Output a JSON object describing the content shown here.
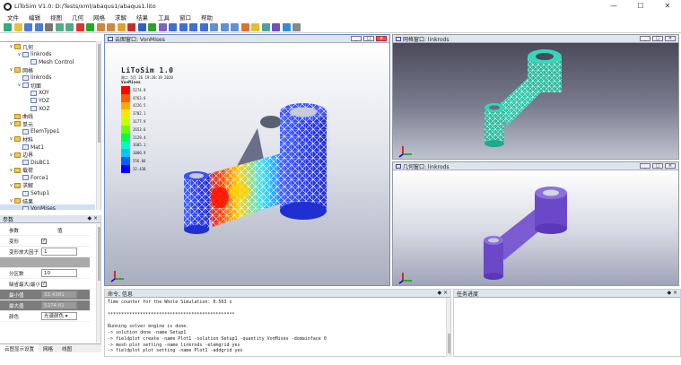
{
  "window": {
    "title": "LiToSim V1.0: D:/Tests/xml/abaqus1/abaqus1.lito",
    "minimize": "—",
    "maximize": "☐",
    "close": "✕"
  },
  "menu": [
    "文件",
    "编辑",
    "视图",
    "几何",
    "网格",
    "求解",
    "结果",
    "工具",
    "窗口",
    "帮助"
  ],
  "toolbar": {
    "icons": [
      "new",
      "open",
      "save",
      "save-all",
      "print",
      "undo",
      "redo",
      "stop",
      "run",
      "import",
      "export",
      "mesh",
      "solve",
      "post",
      "play",
      "select",
      "rotate",
      "pan",
      "zoom",
      "fit",
      "view-front",
      "view-top",
      "view-iso",
      "color",
      "light",
      "wire",
      "shade",
      "export-image",
      "settings"
    ],
    "colors": [
      "#3a7",
      "#e8c040",
      "#4a7ed0",
      "#4a7ed0",
      "#777",
      "#5a8",
      "#5a8",
      "#d33",
      "#2a2",
      "#c84",
      "#c84",
      "#e0a030",
      "#c03030",
      "#3060c0",
      "#30a030",
      "#8060c0",
      "#4070d0",
      "#4070d0",
      "#4070d0",
      "#4070d0",
      "#6090d0",
      "#6090d0",
      "#6090d0",
      "#e07030",
      "#e0c030",
      "#50a0a0",
      "#7050c0",
      "#3090d0",
      "#888"
    ]
  },
  "tree_panel": {
    "header": "项目",
    "buttons": "◆ ×",
    "items": [
      {
        "label": "几何",
        "depth": 1,
        "expand": "∨"
      },
      {
        "label": "linkrods",
        "depth": 2,
        "expand": "∨"
      },
      {
        "label": "Mesh Control",
        "depth": 3,
        "expand": ""
      },
      {
        "label": "网格",
        "depth": 1,
        "expand": "∨"
      },
      {
        "label": "linkrods",
        "depth": 2,
        "expand": ""
      },
      {
        "label": "切面",
        "depth": 2,
        "expand": "∨"
      },
      {
        "label": "XOY",
        "depth": 3,
        "expand": ""
      },
      {
        "label": "YOZ",
        "depth": 3,
        "expand": ""
      },
      {
        "label": "XOZ",
        "depth": 3,
        "expand": ""
      },
      {
        "label": "曲线",
        "depth": 1,
        "expand": ""
      },
      {
        "label": "单元",
        "depth": 1,
        "expand": "∨"
      },
      {
        "label": "ElemType1",
        "depth": 2,
        "expand": ""
      },
      {
        "label": "材料",
        "depth": 1,
        "expand": "∨"
      },
      {
        "label": "Mat1",
        "depth": 2,
        "expand": ""
      },
      {
        "label": "边界",
        "depth": 1,
        "expand": "∨"
      },
      {
        "label": "DisBC1",
        "depth": 2,
        "expand": ""
      },
      {
        "label": "载荷",
        "depth": 1,
        "expand": "∨"
      },
      {
        "label": "Force1",
        "depth": 2,
        "expand": ""
      },
      {
        "label": "求解",
        "depth": 1,
        "expand": "∨"
      },
      {
        "label": "Setup1",
        "depth": 2,
        "expand": ""
      },
      {
        "label": "结果",
        "depth": 1,
        "expand": "∨"
      },
      {
        "label": "VonMises",
        "depth": 2,
        "expand": "",
        "selected": true
      }
    ]
  },
  "params_panel": {
    "header": "参数",
    "buttons": "◆ ×",
    "col1": "参数",
    "col2": "值",
    "rows": [
      {
        "label": "变形",
        "type": "check",
        "value": "✓"
      },
      {
        "label": "变形放大因子",
        "type": "input",
        "value": "1"
      },
      {
        "label": "",
        "type": "gray",
        "value": ""
      },
      {
        "label": "分区数",
        "type": "input",
        "value": "10"
      },
      {
        "label": "缺省最大/最小",
        "type": "check",
        "value": "✓"
      },
      {
        "label": "最小值",
        "type": "input-dark",
        "value": "32.4381"
      },
      {
        "label": "最大值",
        "type": "input-dark",
        "value": "5274.81"
      },
      {
        "label": "颜色",
        "type": "select",
        "value": "光谱颜色"
      }
    ],
    "tabs": [
      "云图显示设置",
      "网格",
      "线图"
    ]
  },
  "viewports": {
    "main": {
      "title": "云图窗口: VonMises"
    },
    "mesh": {
      "title": "网格窗口: linkrods"
    },
    "geom": {
      "title": "几何窗口: linkrods"
    }
  },
  "contour": {
    "app": "LiToSim 1.0",
    "date": "周二 5月 26 19:28:19 2020",
    "variable": "VonMises",
    "levels": [
      "5274.8",
      "4763.6",
      "4226.5",
      "3702.1",
      "3177.9",
      "2653.6",
      "2129.4",
      "1605.1",
      "1080.9",
      "556.66",
      "32.438"
    ],
    "colors": [
      "#ff0000",
      "#ff5a00",
      "#ffaa00",
      "#ffe800",
      "#c8ff00",
      "#6aff00",
      "#00ff40",
      "#00ffc8",
      "#00c8ff",
      "#0060ff",
      "#0000ff"
    ]
  },
  "console": {
    "header": "命令, 信息",
    "buttons": "◆ ×",
    "lines": [
      "Time counter for the Whole Simulation: 0.503 s",
      "",
      "***********************************************",
      "",
      "Running solver engine is done.",
      "-> solution done -name Setup1",
      "-> fieldplot create -name Plot1 -solution Setup1 -quantity VonMises -domainface 0",
      "-> mesh plot setting -name linkrods -elemgrid yes",
      "-> fieldplot plot setting -name Plot1 -addgrid yes"
    ]
  },
  "task_panel": {
    "header": "任务进度",
    "buttons": "◆ ×"
  },
  "axes": {
    "x": "X",
    "y": "Y",
    "z": "Z"
  }
}
